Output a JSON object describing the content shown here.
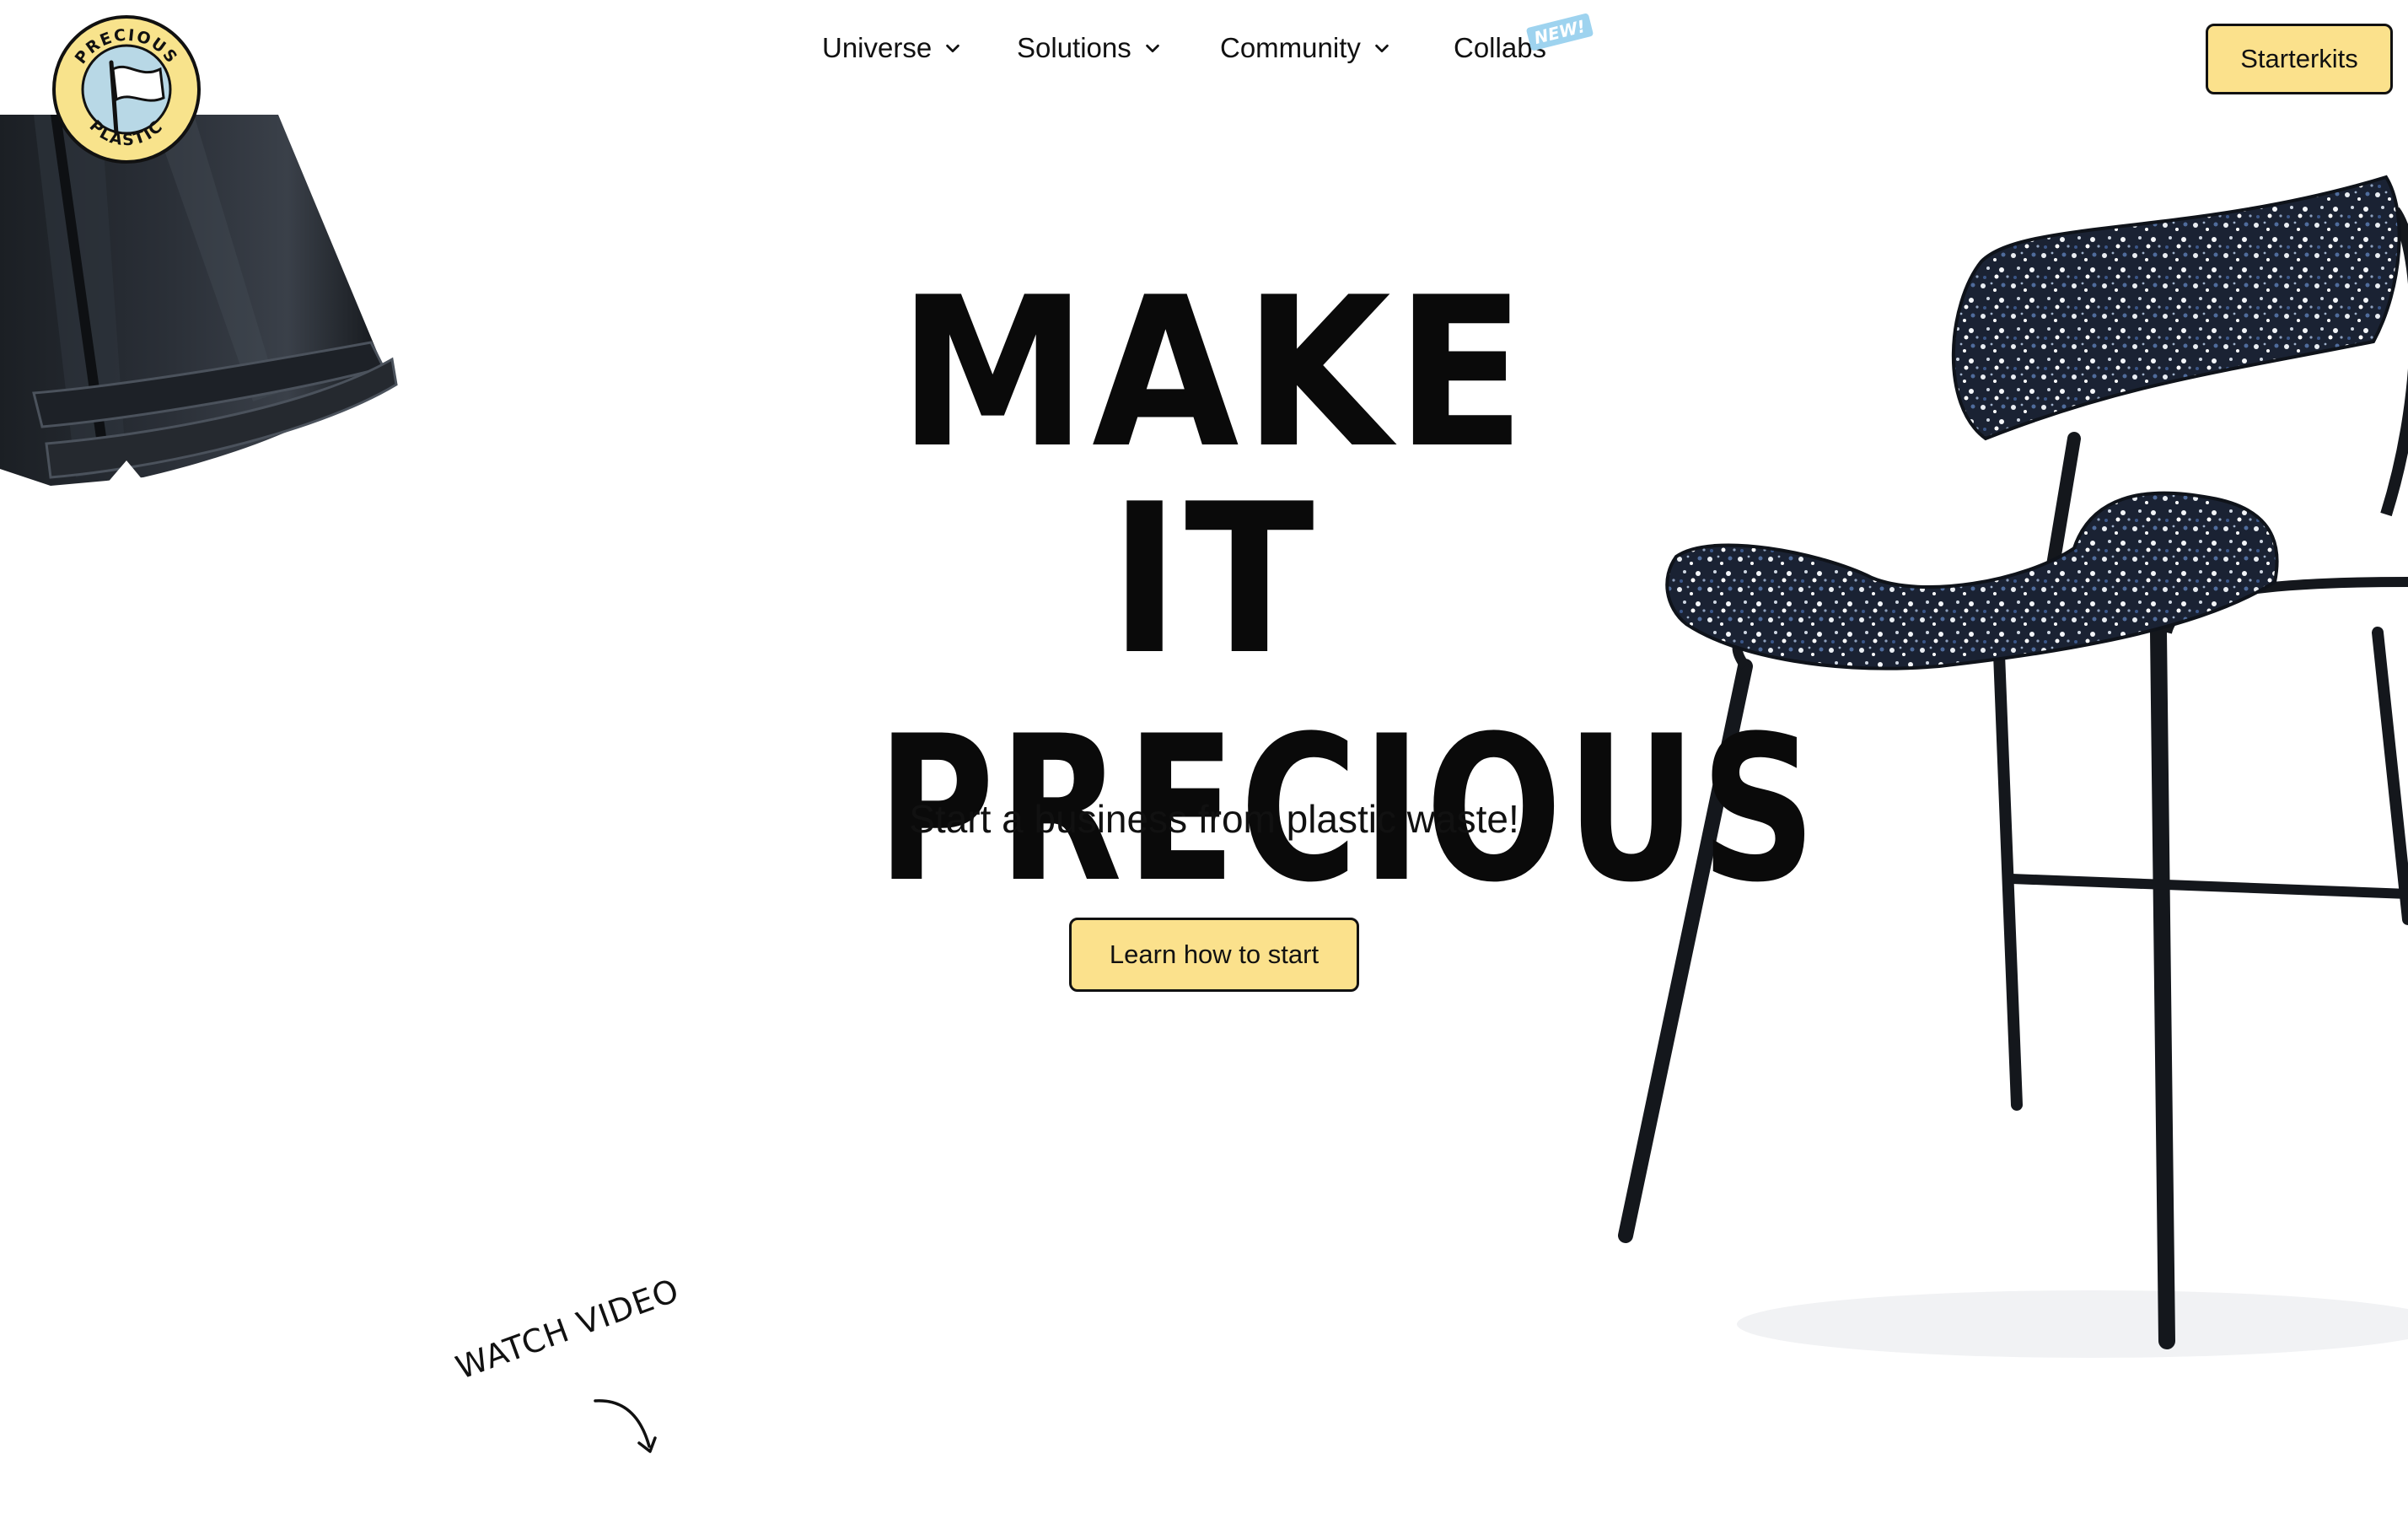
{
  "logo": {
    "top_text": "PRECIOUS",
    "bottom_text": "PLASTIC"
  },
  "nav": {
    "items": [
      {
        "label": "Universe",
        "has_dropdown": true
      },
      {
        "label": "Solutions",
        "has_dropdown": true
      },
      {
        "label": "Community",
        "has_dropdown": true
      },
      {
        "label": "Collabs",
        "has_dropdown": false
      }
    ],
    "new_badge": "NEW!",
    "cta_label": "Starterkits"
  },
  "hero": {
    "title_line1": "MAKE IT",
    "title_line2": "PRECIOUS",
    "subtitle": "Start a business from plastic waste!",
    "cta_label": "Learn how to start"
  },
  "watch_video": {
    "label": "WATCH VIDEO"
  },
  "colors": {
    "accent_yellow": "#fbe18c",
    "badge_blue": "#9ed3ef",
    "logo_blue": "#b8d8e6",
    "text": "#111111",
    "background": "#ffffff"
  }
}
